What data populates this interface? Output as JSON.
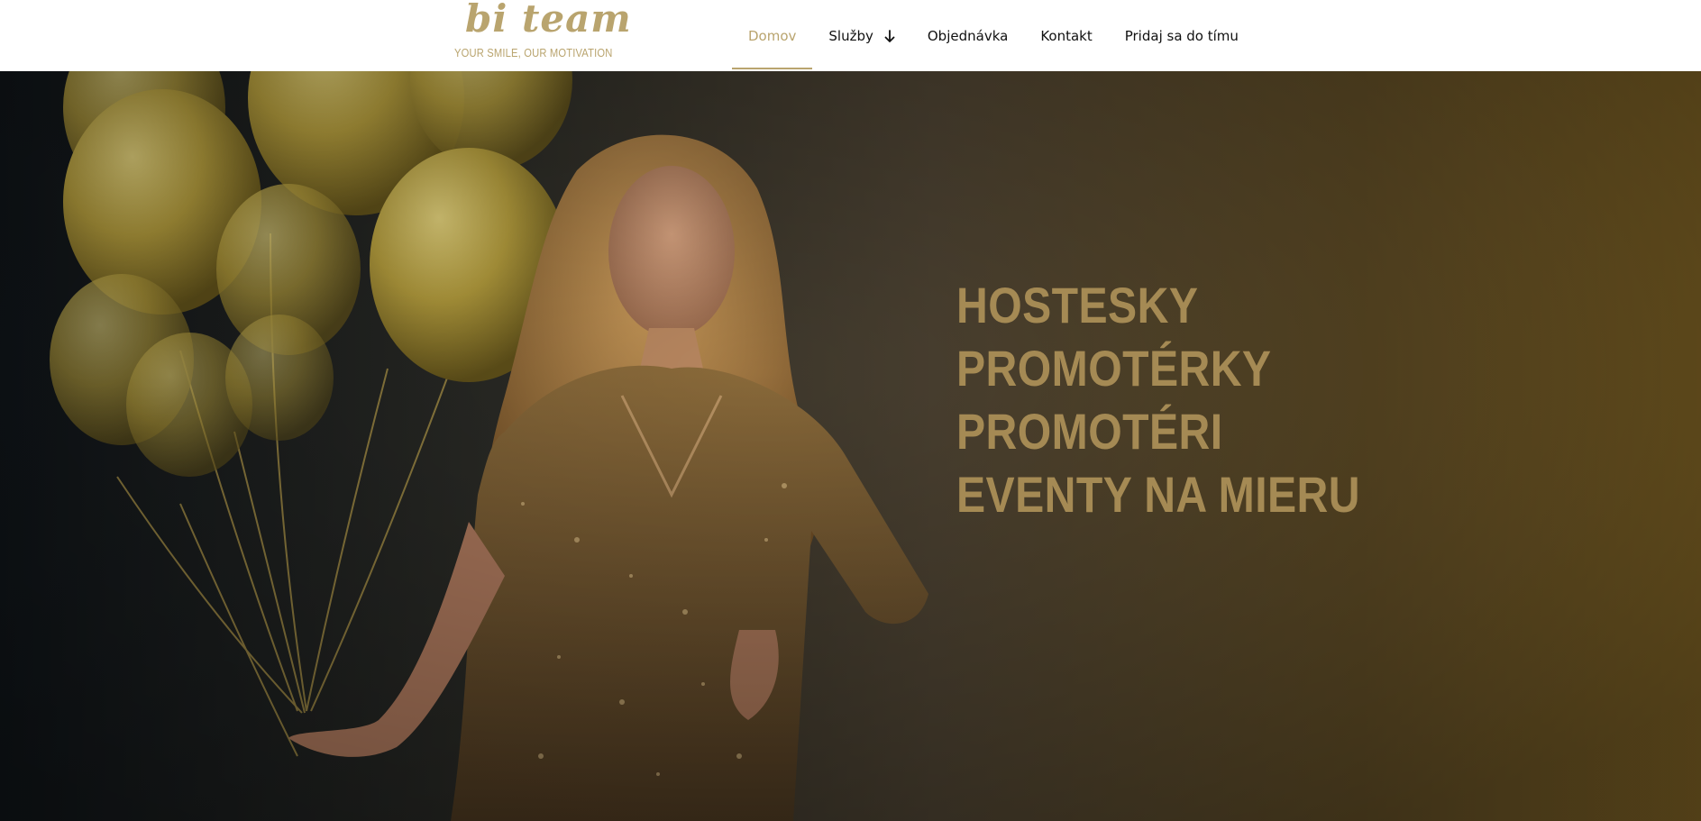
{
  "brand": {
    "name": "bi team",
    "tagline": "YOUR SMILE, OUR MOTIVATION",
    "logo_color": "#b9a46e"
  },
  "nav": {
    "items": [
      {
        "label": "Domov",
        "active": true
      },
      {
        "label": "Služby",
        "has_dropdown": true,
        "icon": "arrow-down-icon"
      },
      {
        "label": "Objednávka"
      },
      {
        "label": "Kontakt"
      },
      {
        "label": "Pridaj sa do tímu"
      }
    ],
    "active_color": "#b9a46e",
    "text_color": "#111111"
  },
  "hero": {
    "lines": [
      "HOSTESKY",
      "PROMOTÉRKY",
      "PROMOTÉRI",
      "EVENTY NA MIERU"
    ],
    "text_color": "#a58a54",
    "background_description": "woman in gold sequin dress holding gold balloons",
    "gradient_colors": [
      "#10161a",
      "#3a372d",
      "#6b5528",
      "#8a6a2a"
    ]
  },
  "colors": {
    "accent": "#b9a46e",
    "header_bg": "#ffffff"
  }
}
